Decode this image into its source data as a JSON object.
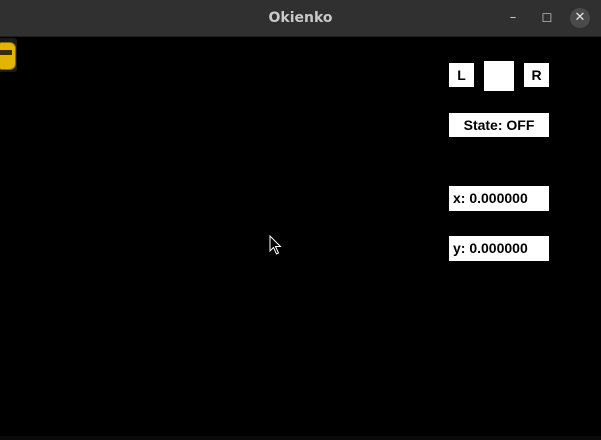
{
  "window": {
    "title": "Okienko",
    "controls": {
      "minimize": "–",
      "maximize": "☐",
      "close": "✕"
    }
  },
  "panel": {
    "left_button": "L",
    "right_button": "R",
    "state": "State: OFF",
    "x": "x: 0.000000",
    "y": "y: 0.000000"
  },
  "colors": {
    "titlebar": "#303030",
    "background": "#000000",
    "car": "#e3b400",
    "panel": "#ffffff"
  },
  "icons": {
    "car": "yellow-car-icon",
    "cursor": "mouse-pointer-icon"
  }
}
